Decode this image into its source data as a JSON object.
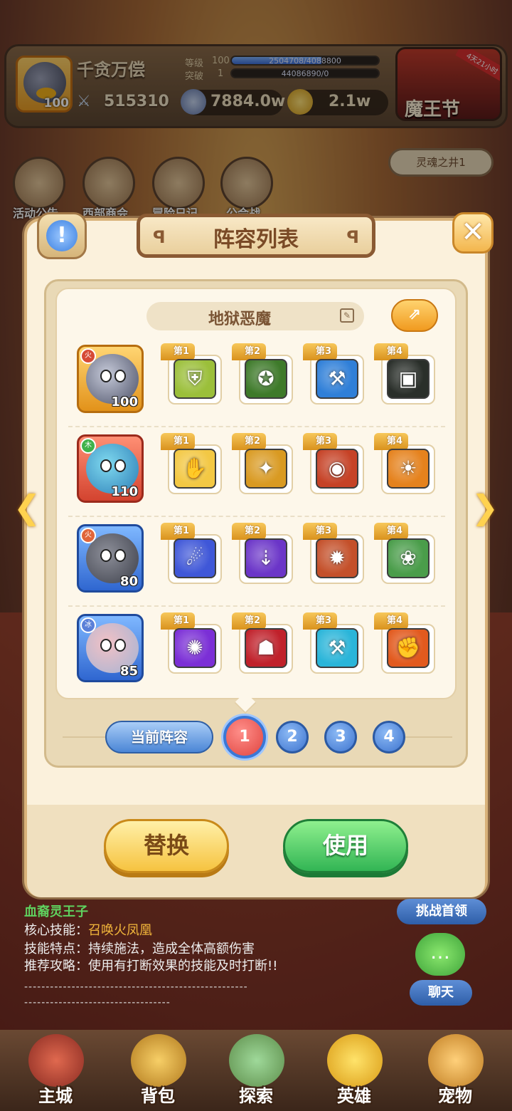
{
  "player": {
    "name": "千贪万偿",
    "level": "100",
    "power": "515310",
    "rank_label": "等级",
    "rank_value": "100",
    "rank_bar_text": "2504708/4088800",
    "rank_progress": 0.61,
    "break_label": "突破",
    "break_value": "1",
    "break_bar_text": "44086890/0",
    "break_progress": 0.0
  },
  "resources": {
    "soul": "7884.0w",
    "coin": "2.1w"
  },
  "event": {
    "title": "魔王节",
    "tag": "4天21小时"
  },
  "background_menu": {
    "items": [
      "活动公告",
      "西部商会",
      "冒险日记",
      "公会战"
    ],
    "soul_well": "灵魂之井1"
  },
  "panel": {
    "title": "阵容列表",
    "lineup_name": "地狱恶魔",
    "current_lineup_label": "当前阵容",
    "pages": [
      "1",
      "2",
      "3",
      "4"
    ],
    "active_page": "1",
    "replace_label": "替换",
    "use_label": "使用"
  },
  "lineup": [
    {
      "hero_level": "100",
      "element": "火",
      "skills": [
        {
          "tag": "第1",
          "icon": "gold-shield-icon"
        },
        {
          "tag": "第2",
          "icon": "star-shield-icon"
        },
        {
          "tag": "第3",
          "icon": "ice-axe-icon"
        },
        {
          "tag": "第4",
          "icon": "dark-cage-icon"
        }
      ]
    },
    {
      "hero_level": "110",
      "element": "木",
      "skills": [
        {
          "tag": "第1",
          "icon": "puppet-hand-icon"
        },
        {
          "tag": "第2",
          "icon": "gold-beast-icon"
        },
        {
          "tag": "第3",
          "icon": "eye-orb-icon"
        },
        {
          "tag": "第4",
          "icon": "fire-dragon-icon"
        }
      ]
    },
    {
      "hero_level": "80",
      "element": "火",
      "skills": [
        {
          "tag": "第1",
          "icon": "meteor-icon"
        },
        {
          "tag": "第2",
          "icon": "purple-rain-icon"
        },
        {
          "tag": "第3",
          "icon": "tree-demon-icon"
        },
        {
          "tag": "第4",
          "icon": "peach-plant-icon"
        }
      ]
    },
    {
      "hero_level": "85",
      "element": "冰",
      "skills": [
        {
          "tag": "第1",
          "icon": "arcane-circle-icon"
        },
        {
          "tag": "第2",
          "icon": "red-mask-icon"
        },
        {
          "tag": "第3",
          "icon": "frost-hammer-icon"
        },
        {
          "tag": "第4",
          "icon": "fire-fist-icon"
        }
      ]
    }
  ],
  "boss_info": {
    "name": "血裔灵王子",
    "skill_label": "核心技能：",
    "skill_value": "召唤火凤凰",
    "feature_line": "技能特点：持续施法，造成全体高额伤害",
    "tip_line": "推荐攻略：使用有打断效果的技能及时打断!!",
    "dashes1": "----------------------------------------------------",
    "dashes2": "----------------------------------",
    "challenge_label": "挑战首领",
    "chat_label": "聊天"
  },
  "nav": {
    "items": [
      "主城",
      "背包",
      "探索",
      "英雄",
      "宠物"
    ]
  },
  "colors": {
    "panel_bg": "#fbf1dc",
    "replace_button": "#f6c340",
    "use_button": "#32b554",
    "active_page": "#e0443f",
    "page_dot": "#3e74cf"
  }
}
